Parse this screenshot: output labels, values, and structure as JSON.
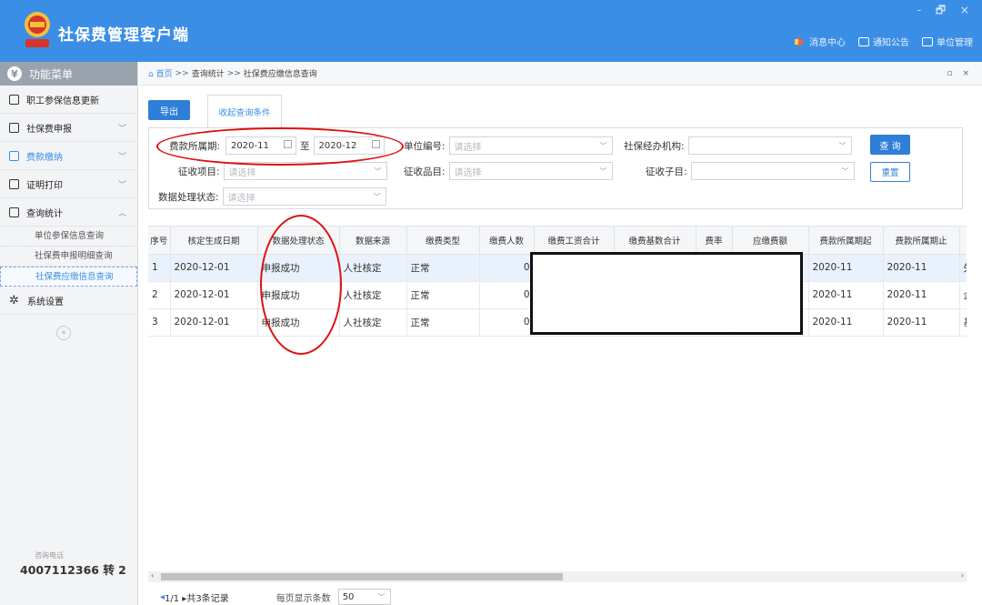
{
  "app": {
    "title": "社保费管理客户端",
    "window_controls": "- 🗗 ×"
  },
  "header_nav": [
    {
      "label": "消息中心",
      "icon": "speaker-icon"
    },
    {
      "label": "通知公告",
      "icon": "mail-icon"
    },
    {
      "label": "单位管理",
      "icon": "building-icon"
    }
  ],
  "sidebar": {
    "title": "功能菜单",
    "items": [
      {
        "label": "职工参保信息更新"
      },
      {
        "label": "社保费申报",
        "chevron": "﹀"
      },
      {
        "label": "费款缴纳",
        "chevron": "﹀"
      },
      {
        "label": "证明打印",
        "chevron": "﹀"
      },
      {
        "label": "查询统计",
        "chevron": "︿"
      }
    ],
    "submenu": [
      "单位参保信息查询",
      "社保费申报明细查询",
      "社保费应缴信息查询"
    ],
    "settings": "系统设置",
    "contact_label": "咨询电话",
    "contact_phone": "4007112366 转 2"
  },
  "breadcrumb": {
    "home": "首页",
    "sep": ">>",
    "level1": "查询统计",
    "level2": "社保费应缴信息查询",
    "controls": "▫ ×"
  },
  "toolbar": {
    "export": "导出",
    "collapse_tab": "收起查询条件"
  },
  "form": {
    "period_label": "费款所属期:",
    "period_from": "2020-11",
    "to": "至",
    "period_to": "2020-12",
    "unit_no_label": "单位编号:",
    "unit_no_ph": "请选择",
    "agency_label": "社保经办机构:",
    "item_label": "征收项目:",
    "item_ph": "请选择",
    "category_label": "征收品目:",
    "category_ph": "请选择",
    "subitem_label": "征收子目:",
    "status_label": "数据处理状态:",
    "status_ph": "请选择",
    "query_btn": "查 询",
    "reset_btn": "重置"
  },
  "table": {
    "columns": [
      "序号",
      "核定生成日期",
      "数据处理状态",
      "数据来源",
      "缴费类型",
      "缴费人数",
      "缴费工资合计",
      "缴费基数合计",
      "费率",
      "应缴费额",
      "费款所属期起",
      "费款所属期止",
      ""
    ],
    "rows": [
      [
        "1",
        "2020-12-01",
        "申报成功",
        "人社核定",
        "正常",
        "0",
        "",
        "",
        "",
        "",
        "2020-11",
        "2020-11",
        "失业"
      ],
      [
        "2",
        "2020-12-01",
        "申报成功",
        "人社核定",
        "正常",
        "0",
        "",
        "",
        "",
        "",
        "2020-11",
        "2020-11",
        "企业"
      ],
      [
        "3",
        "2020-12-01",
        "申报成功",
        "人社核定",
        "正常",
        "0",
        "",
        "",
        "",
        "",
        "2020-11",
        "2020-11",
        "基本"
      ]
    ]
  },
  "pager": {
    "info": "1/1 ▸共3条记录",
    "per_page_label": "每页显示条数",
    "per_page": "50"
  },
  "colors": {
    "header": "#3a8ee6",
    "primary": "#2f7ed8",
    "annotation": "#dd1111"
  }
}
